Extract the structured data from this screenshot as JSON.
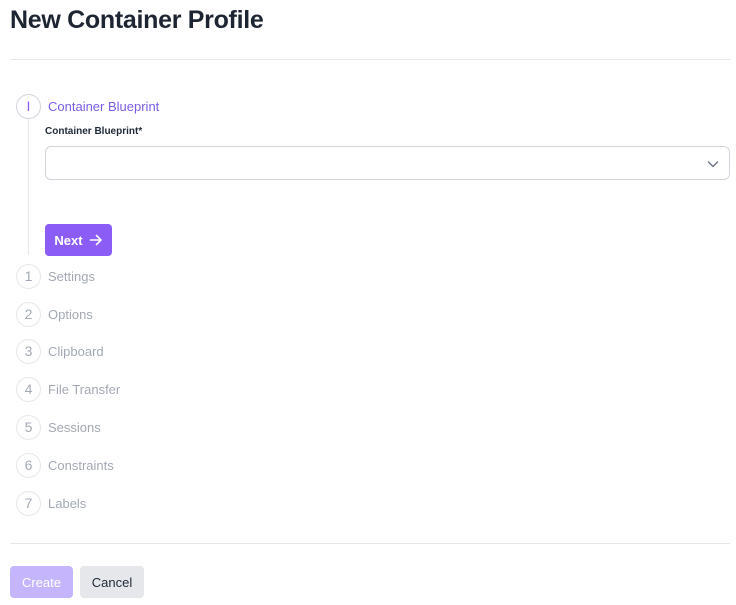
{
  "page": {
    "title": "New Container Profile"
  },
  "stepper": {
    "active_step": {
      "marker": "I",
      "label": "Container Blueprint"
    },
    "steps": [
      {
        "number": "1",
        "label": "Settings"
      },
      {
        "number": "2",
        "label": "Options"
      },
      {
        "number": "3",
        "label": "Clipboard"
      },
      {
        "number": "4",
        "label": "File Transfer"
      },
      {
        "number": "5",
        "label": "Sessions"
      },
      {
        "number": "6",
        "label": "Constraints"
      },
      {
        "number": "7",
        "label": "Labels"
      }
    ]
  },
  "form": {
    "blueprint_label": "Container Blueprint*",
    "blueprint_value": "",
    "next_label": "Next"
  },
  "footer": {
    "create_label": "Create",
    "cancel_label": "Cancel"
  },
  "colors": {
    "accent": "#8b5cf6",
    "accent_disabled": "#c4b5fd",
    "muted_text": "#a3a9b4"
  }
}
